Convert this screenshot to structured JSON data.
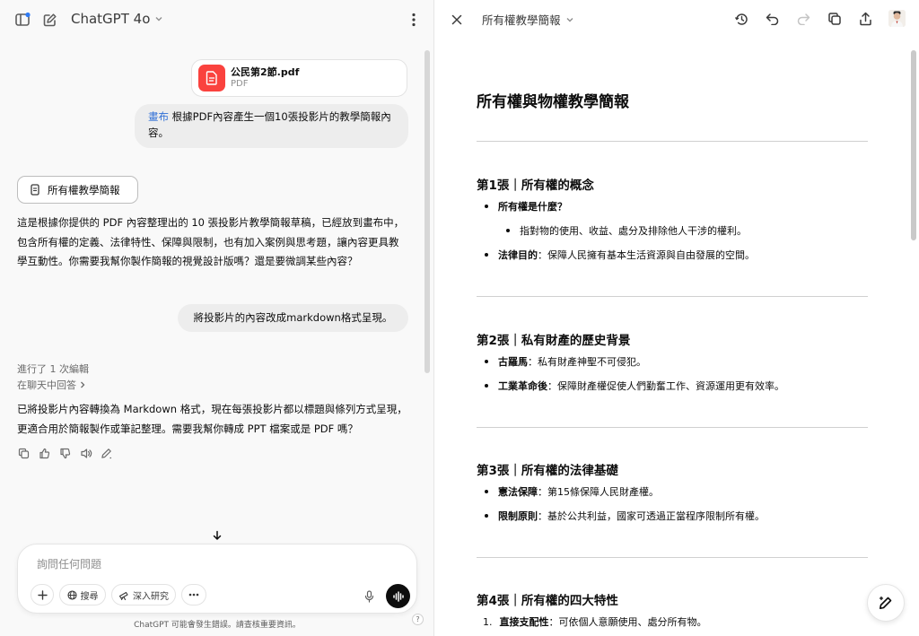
{
  "left": {
    "model_name": "ChatGPT 4o",
    "attachment": {
      "name": "公民第2節.pdf",
      "type": "PDF"
    },
    "user_msg1": {
      "highlight": "畫布",
      "text": " 根據PDF內容產生一個10張投影片的教學簡報內容。"
    },
    "canvas_button_label": "所有權教學簡報",
    "assistant_msg1": "這是根據你提供的 PDF 內容整理出的 10 張投影片教學簡報草稿，已經放到畫布中，包含所有權的定義、法律特性、保障與限制，也有加入案例與思考題，讓內容更具教學互動性。你需要我幫你製作簡報的視覺設計版嗎？還是要微調某些內容？",
    "user_msg2": "將投影片的內容改成markdown格式呈現。",
    "edit_note": "進行了 1 次編輯",
    "reply_in_chat": "在聊天中回答",
    "assistant_msg2": "已將投影片內容轉換為 Markdown 格式，現在每張投影片都以標題與條列方式呈現，更適合用於簡報製作或筆記整理。需要我幫你轉成 PPT 檔案或是 PDF 嗎？",
    "composer": {
      "placeholder": "詢問任何問題",
      "search_label": "搜尋",
      "research_label": "深入研究"
    },
    "disclaimer": "ChatGPT 可能會發生錯誤。請查核重要資訊。",
    "help_label": "?"
  },
  "right": {
    "title": "所有權教學簡報",
    "doc_title": "所有權與物權教學簡報",
    "slides": [
      {
        "heading": "第1張｜所有權的概念",
        "b1": "所有權是什麼？",
        "b1_sub": "指對物的使用、收益、處分及排除他人干涉的權利。",
        "b2_label": "法律目的",
        "b2_text": "：保障人民擁有基本生活資源與自由發展的空間。"
      },
      {
        "heading": "第2張｜私有財產的歷史背景",
        "b1_label": "古羅馬",
        "b1_text": "：私有財產神聖不可侵犯。",
        "b2_label": "工業革命後",
        "b2_text": "：保障財產權促使人們勤奮工作、資源運用更有效率。"
      },
      {
        "heading": "第3張｜所有權的法律基礎",
        "b1_label": "憲法保障",
        "b1_text": "：第15條保障人民財產權。",
        "b2_label": "限制原則",
        "b2_text": "：基於公共利益，國家可透過正當程序限制所有權。"
      },
      {
        "heading": "第4張｜所有權的四大特性",
        "b1_num": "1.",
        "b1_label": "直接支配性",
        "b1_text": "：可依個人意願使用、處分所有物。"
      }
    ]
  }
}
